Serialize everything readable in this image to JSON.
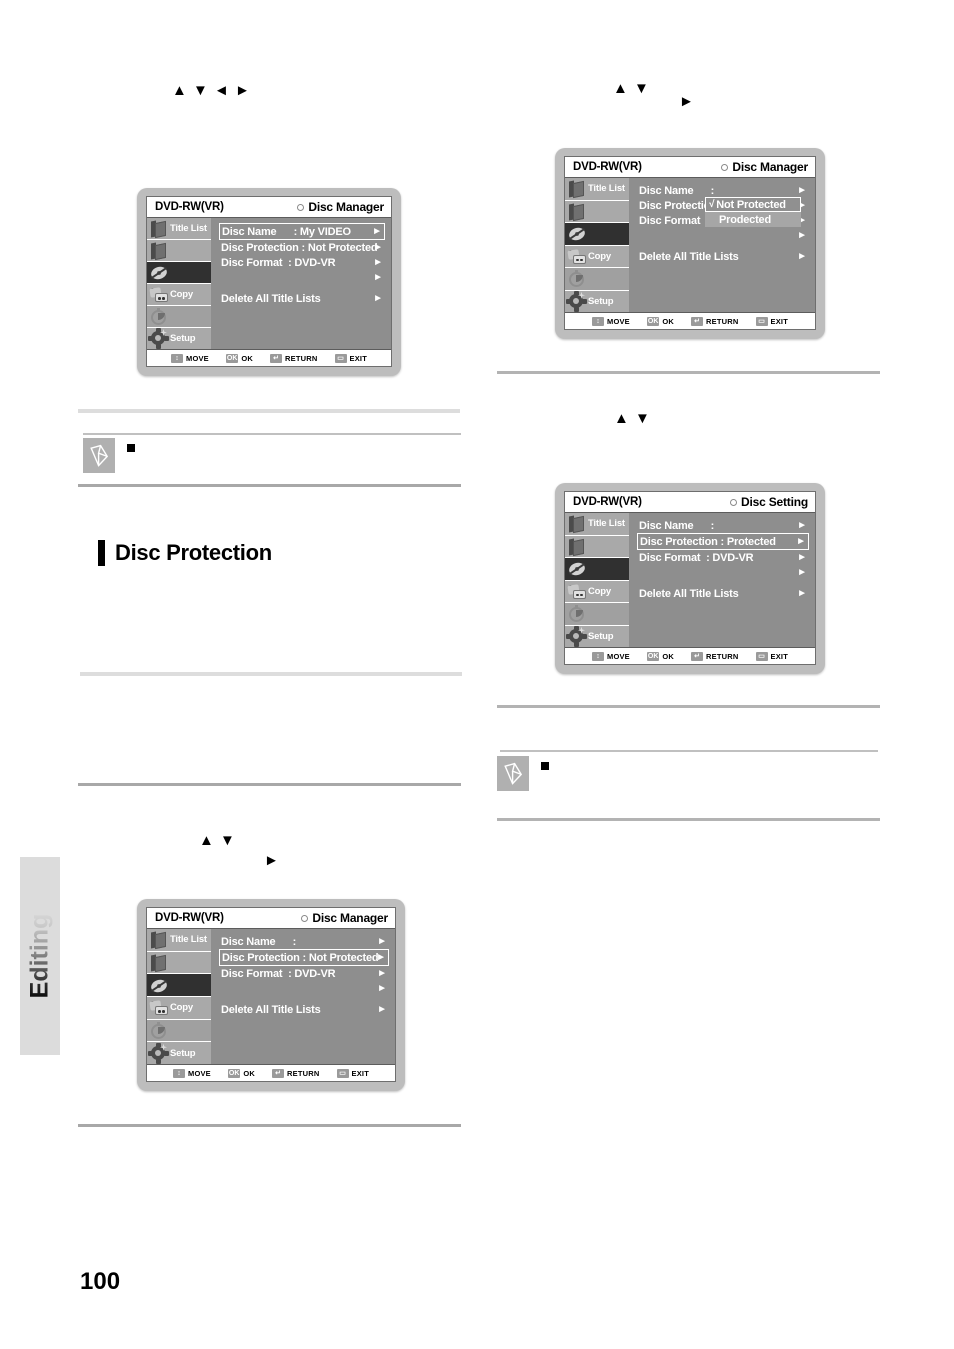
{
  "page": {
    "number": "100",
    "side_tab_label": "Editing"
  },
  "section": {
    "title": "Disc Protection",
    "bar_color": "#000000"
  },
  "notes": [
    {
      "id": "note-left",
      "bullet": "■"
    },
    {
      "id": "note-right",
      "bullet": "■"
    }
  ],
  "arrow_clusters": {
    "left_top": {
      "glyphs": "▲ ▼ ◄ ►"
    },
    "right_top_a": {
      "glyphs": "▲ ▼"
    },
    "right_top_b": {
      "glyphs": "►"
    },
    "right_mid": {
      "glyphs": "▲ ▼"
    },
    "left_bottom_a": {
      "glyphs": "▲ ▼"
    },
    "left_bottom_b": {
      "glyphs": "►"
    }
  },
  "osd_common": {
    "disc_type": "DVD-RW(VR)",
    "caret": "►",
    "sidebar": [
      {
        "name": "title-list",
        "label": "Title List",
        "icon": "book-icon",
        "state": "normal"
      },
      {
        "name": "playlist",
        "label": "",
        "icon": "book-icon",
        "state": "normal"
      },
      {
        "name": "disc-manager",
        "label": "",
        "icon": "disc-icon",
        "state": "selected"
      },
      {
        "name": "copy",
        "label": "Copy",
        "icon": "copy-icon",
        "state": "normal"
      },
      {
        "name": "timer",
        "label": "",
        "icon": "timer-icon",
        "state": "dim"
      },
      {
        "name": "setup",
        "label": "Setup",
        "icon": "gear-icon",
        "state": "normal"
      }
    ],
    "footer_keys": [
      {
        "badge": "↕",
        "label": "MOVE"
      },
      {
        "badge": "OK",
        "label": "OK"
      },
      {
        "badge": "↵",
        "label": "RETURN"
      },
      {
        "badge": "▭",
        "label": "EXIT"
      }
    ]
  },
  "osd_screens": [
    {
      "id": "osd-1",
      "screen_name": "Disc Manager",
      "rows": [
        {
          "text": "Disc Name      : My VIDEO",
          "highlighted": true,
          "caret": true
        },
        {
          "text": "Disc Protection : Not Protected",
          "highlighted": false,
          "caret": true
        },
        {
          "text": "Disc Format  : DVD-VR",
          "highlighted": false,
          "caret": true
        },
        {
          "text": "",
          "highlighted": false,
          "caret": true
        },
        {
          "text": "Delete All Title Lists",
          "highlighted": false,
          "caret": true,
          "gap_before": true
        }
      ],
      "popup": null
    },
    {
      "id": "osd-2",
      "screen_name": "Disc Manager",
      "rows": [
        {
          "text": "Disc Name      :",
          "highlighted": false,
          "caret": true
        },
        {
          "text": "Disc Protection",
          "highlighted": false,
          "caret": true
        },
        {
          "text": "Disc Format  :",
          "highlighted": false,
          "caret": true
        },
        {
          "text": "",
          "highlighted": false,
          "caret": true
        },
        {
          "text": "Delete All Title Lists",
          "highlighted": false,
          "caret": true,
          "gap_before": true
        }
      ],
      "popup": {
        "name": "disc-protection-dropdown",
        "items": [
          {
            "label": "Not Protected",
            "checked": true,
            "selected": true
          },
          {
            "label": "Prodected",
            "checked": false,
            "selected": false
          }
        ],
        "check_glyph": "√"
      }
    },
    {
      "id": "osd-3",
      "screen_name": "Disc Setting",
      "rows": [
        {
          "text": "Disc Name      :",
          "highlighted": false,
          "caret": true
        },
        {
          "text": "Disc Protection : Protected",
          "highlighted": true,
          "caret": true
        },
        {
          "text": "Disc Format  : DVD-VR",
          "highlighted": false,
          "caret": true
        },
        {
          "text": "",
          "highlighted": false,
          "caret": true
        },
        {
          "text": "Delete All Title Lists",
          "highlighted": false,
          "caret": true,
          "gap_before": true
        }
      ],
      "popup": null
    },
    {
      "id": "osd-4",
      "screen_name": "Disc Manager",
      "rows": [
        {
          "text": "Disc Name      :",
          "highlighted": false,
          "caret": true
        },
        {
          "text": "Disc Protection : Not Protected",
          "highlighted": true,
          "caret": true
        },
        {
          "text": "Disc Format  : DVD-VR",
          "highlighted": false,
          "caret": true
        },
        {
          "text": "",
          "highlighted": false,
          "caret": true
        },
        {
          "text": "Delete All Title Lists",
          "highlighted": false,
          "caret": true,
          "gap_before": true
        }
      ],
      "popup": null
    }
  ]
}
